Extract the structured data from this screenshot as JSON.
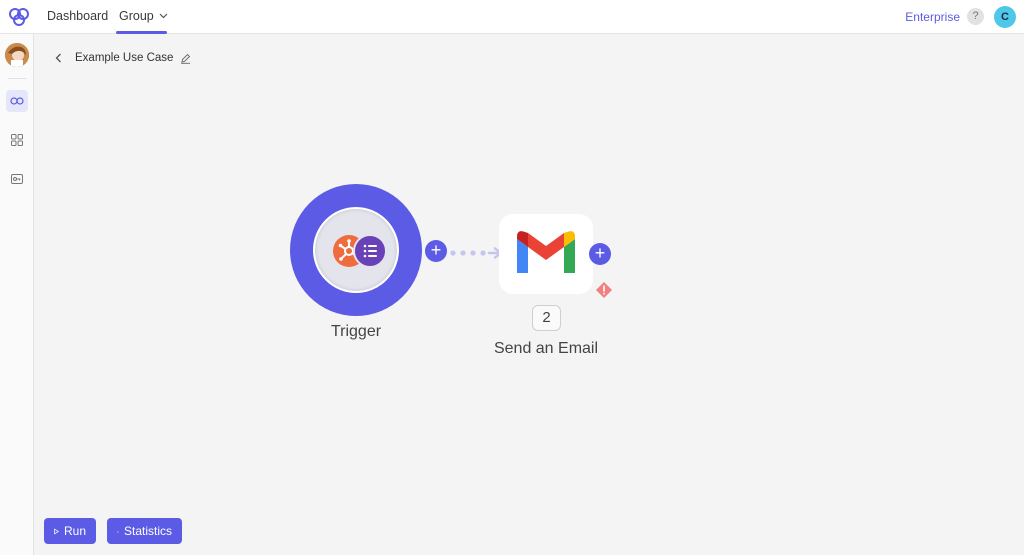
{
  "topbar": {
    "nav": {
      "dashboard": "Dashboard",
      "group": "Group"
    },
    "plan_label": "Enterprise",
    "help_label": "?",
    "user_initial": "C"
  },
  "breadcrumb": {
    "title": "Example Use Case"
  },
  "canvas": {
    "trigger": {
      "label": "Trigger",
      "icons": [
        "hubspot-icon",
        "list-icon"
      ]
    },
    "action": {
      "step_number": "2",
      "label": "Send an Email",
      "icon": "gmail-icon",
      "status": "warning"
    },
    "add_symbol": "+"
  },
  "bottom": {
    "run_label": "Run",
    "statistics_label": "Statistics"
  },
  "colors": {
    "accent": "#5b5be6",
    "avatar": "#4fc7e9",
    "hubspot": "#ef6c3e",
    "list": "#6a42b8",
    "warning": "#f08080"
  }
}
